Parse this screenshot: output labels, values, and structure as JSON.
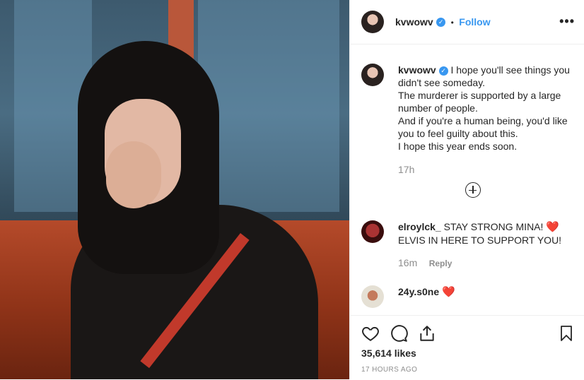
{
  "post": {
    "username": "kvwowv",
    "verified_glyph": "✓",
    "separator": "•",
    "follow_label": "Follow",
    "more_options_glyph": "•••",
    "photo_alt": "Post image"
  },
  "caption": {
    "username": "kvwowv",
    "lines": [
      "I hope you'll see things you didn't see someday.",
      "The murderer is supported by a large number of people.",
      "And if you're a human being, you'd like you to feel guilty about this.",
      "I hope this year ends soon."
    ],
    "time": "17h"
  },
  "comments": [
    {
      "username": "elroylck_",
      "text": "STAY STRONG MINA!",
      "emoji": "❤️",
      "text2": "ELVIS IN HERE TO SUPPORT YOU!",
      "time": "16m",
      "reply_label": "Reply"
    },
    {
      "username": "24y.s0ne",
      "text": "",
      "emoji": "❤️"
    }
  ],
  "actions": {
    "likes": "35,614 likes",
    "timestamp": "17 HOURS AGO"
  },
  "colors": {
    "accent": "#3897f0",
    "heart": "#ed4956",
    "muted": "#8e8e8e",
    "text": "#262626"
  },
  "icons": [
    "more-options-icon",
    "verified-badge-icon",
    "load-more-comments-icon",
    "like-icon",
    "comment-icon",
    "share-icon",
    "save-icon"
  ]
}
